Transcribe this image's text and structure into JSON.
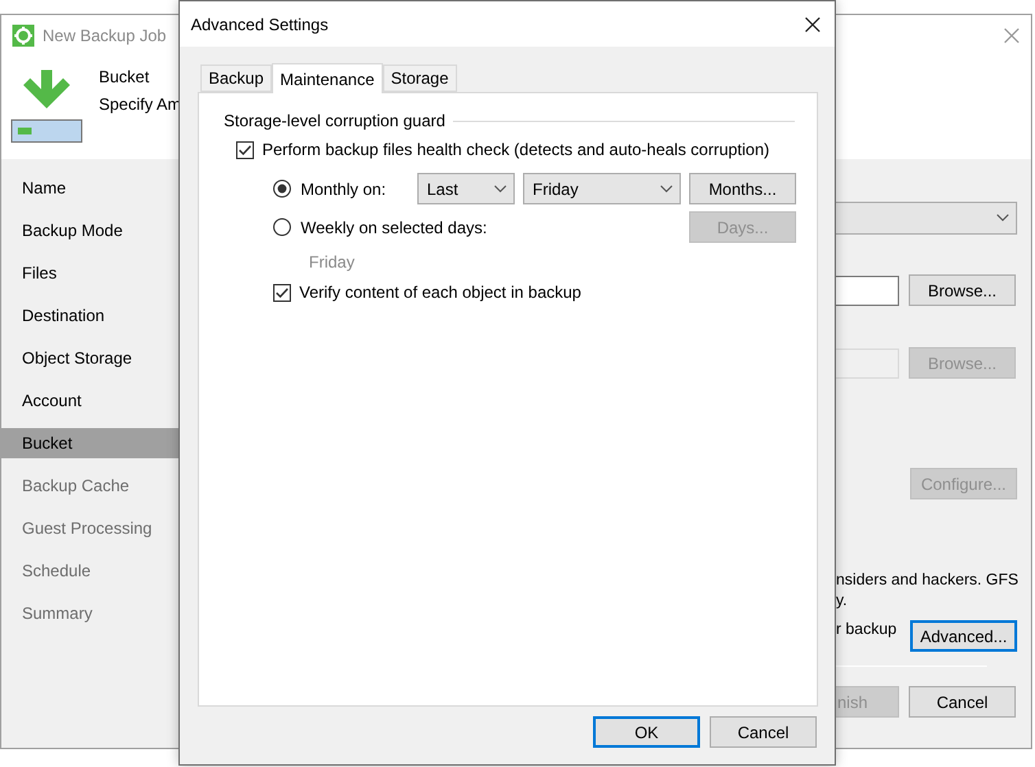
{
  "wizard": {
    "title": "New Backup Job",
    "header": {
      "title": "Bucket",
      "subtitle": "Specify Am"
    },
    "steps": [
      {
        "label": "Name",
        "selected": false,
        "disabled": false
      },
      {
        "label": "Backup Mode",
        "selected": false,
        "disabled": false
      },
      {
        "label": "Files",
        "selected": false,
        "disabled": false
      },
      {
        "label": "Destination",
        "selected": false,
        "disabled": false
      },
      {
        "label": "Object Storage",
        "selected": false,
        "disabled": false
      },
      {
        "label": "Account",
        "selected": false,
        "disabled": false
      },
      {
        "label": "Bucket",
        "selected": true,
        "disabled": false
      },
      {
        "label": "Backup Cache",
        "selected": false,
        "disabled": true
      },
      {
        "label": "Guest Processing",
        "selected": false,
        "disabled": true
      },
      {
        "label": "Schedule",
        "selected": false,
        "disabled": true
      },
      {
        "label": "Summary",
        "selected": false,
        "disabled": true
      }
    ],
    "dropdown": {
      "disabled": false
    },
    "path_rows": [
      {
        "disabled": false,
        "button": "Browse..."
      },
      {
        "disabled": true,
        "button": "Browse..."
      }
    ],
    "configure_button": {
      "label": "Configure...",
      "disabled": true
    },
    "notes": [
      "nsiders and hackers. GFS",
      "y."
    ],
    "advanced_row": {
      "text": "r backup",
      "button": {
        "label": "Advanced...",
        "focused": true
      }
    },
    "footer_buttons": [
      {
        "label": "nish",
        "disabled": true
      },
      {
        "label": "Cancel",
        "disabled": false
      }
    ]
  },
  "dialog": {
    "title": "Advanced Settings",
    "tabs": [
      {
        "label": "Backup",
        "selected": false
      },
      {
        "label": "Maintenance",
        "selected": true
      },
      {
        "label": "Storage",
        "selected": false
      }
    ],
    "group_title": "Storage-level corruption guard",
    "health_check": {
      "label": "Perform backup files health check (detects and auto-heals corruption)",
      "checked": true
    },
    "schedule": [
      {
        "kind": "monthly",
        "label": "Monthly on:",
        "selected": true,
        "occurrence": "Last",
        "day": "Friday",
        "button": {
          "label": "Months...",
          "disabled": false
        }
      },
      {
        "kind": "weekly",
        "label": "Weekly on selected days:",
        "selected": false,
        "days": "Friday",
        "button": {
          "label": "Days...",
          "disabled": true
        }
      }
    ],
    "verify": {
      "label": "Verify content of each object in backup",
      "checked": true
    },
    "buttons": [
      {
        "label": "OK",
        "focused": true
      },
      {
        "label": "Cancel",
        "focused": false
      }
    ]
  }
}
